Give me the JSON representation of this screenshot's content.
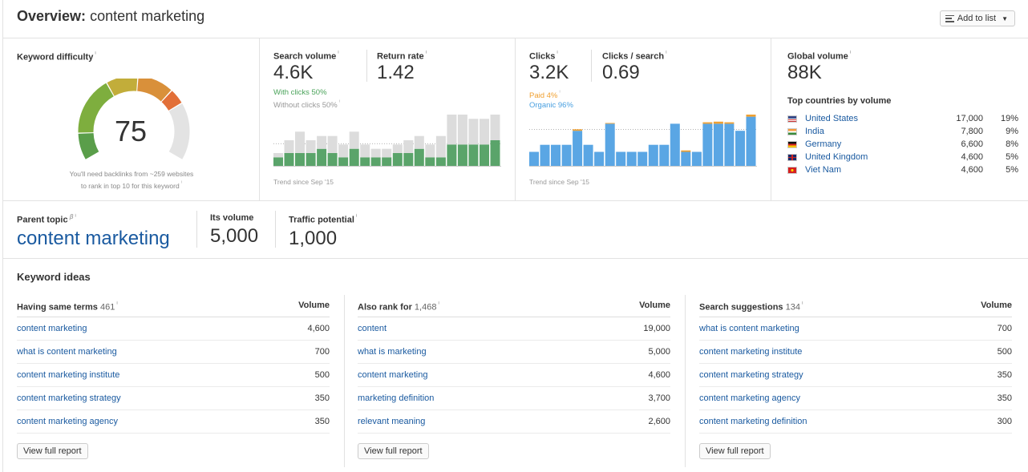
{
  "header": {
    "title_bold": "Overview:",
    "title_query": "content marketing",
    "add_to_list": "Add to list"
  },
  "keyword_difficulty": {
    "label": "Keyword difficulty",
    "value": "75",
    "score": 75,
    "note_line1": "You'll need backlinks from ~259 websites",
    "note_line2": "to rank in top 10 for this keyword"
  },
  "search_volume": {
    "label": "Search volume",
    "value": "4.6K",
    "return_rate_label": "Return rate",
    "return_rate": "1.42",
    "with_clicks": "With clicks 50%",
    "without_clicks": "Without clicks 50%",
    "trend": "Trend since Sep '15"
  },
  "clicks": {
    "label": "Clicks",
    "value": "3.2K",
    "cps_label": "Clicks / search",
    "cps": "0.69",
    "paid": "Paid 4%",
    "organic": "Organic 96%",
    "trend": "Trend since Sep '15"
  },
  "global": {
    "label": "Global volume",
    "value": "88K",
    "top_label": "Top countries by volume",
    "countries": [
      {
        "name": "United States",
        "volume": "17,000",
        "pct": "19%"
      },
      {
        "name": "India",
        "volume": "7,800",
        "pct": "9%"
      },
      {
        "name": "Germany",
        "volume": "6,600",
        "pct": "8%"
      },
      {
        "name": "United Kingdom",
        "volume": "4,600",
        "pct": "5%"
      },
      {
        "name": "Viet Nam",
        "volume": "4,600",
        "pct": "5%"
      }
    ]
  },
  "parent": {
    "label": "Parent topic",
    "beta": "β",
    "topic": "content marketing",
    "its_volume_label": "Its volume",
    "its_volume": "5,000",
    "traffic_label": "Traffic potential",
    "traffic": "1,000"
  },
  "ideas": {
    "title": "Keyword ideas",
    "volume_label": "Volume",
    "view_full": "View full report",
    "cols": [
      {
        "title": "Having same terms",
        "count": "461",
        "rows": [
          {
            "kw": "content marketing",
            "vol": "4,600"
          },
          {
            "kw": "what is content marketing",
            "vol": "700"
          },
          {
            "kw": "content marketing institute",
            "vol": "500"
          },
          {
            "kw": "content marketing strategy",
            "vol": "350"
          },
          {
            "kw": "content marketing agency",
            "vol": "350"
          }
        ]
      },
      {
        "title": "Also rank for",
        "count": "1,468",
        "rows": [
          {
            "kw": "content",
            "vol": "19,000"
          },
          {
            "kw": "what is marketing",
            "vol": "5,000"
          },
          {
            "kw": "content marketing",
            "vol": "4,600"
          },
          {
            "kw": "marketing definition",
            "vol": "3,700"
          },
          {
            "kw": "relevant meaning",
            "vol": "2,600"
          }
        ]
      },
      {
        "title": "Search suggestions",
        "count": "134",
        "rows": [
          {
            "kw": "what is content marketing",
            "vol": "700"
          },
          {
            "kw": "content marketing institute",
            "vol": "500"
          },
          {
            "kw": "content marketing strategy",
            "vol": "350"
          },
          {
            "kw": "content marketing agency",
            "vol": "350"
          },
          {
            "kw": "content marketing definition",
            "vol": "300"
          }
        ]
      }
    ]
  },
  "colors": {
    "link": "#1a5aa0",
    "green": "#5aa46a",
    "gray_bar": "#dcdcdc",
    "blue": "#5aa6e4",
    "paid": "#f0a030"
  },
  "chart_data": [
    {
      "type": "bar",
      "series": [
        {
          "name": "With clicks",
          "values": [
            2,
            3,
            3,
            3,
            4,
            3,
            2,
            4,
            2,
            2,
            2,
            3,
            3,
            4,
            2,
            2,
            5,
            5,
            5,
            5,
            6
          ]
        },
        {
          "name": "Without clicks",
          "values": [
            1,
            3,
            5,
            3,
            3,
            4,
            3,
            4,
            3,
            2,
            2,
            2,
            3,
            3,
            3,
            5,
            7,
            7,
            6,
            6,
            6
          ]
        }
      ]
    },
    {
      "type": "bar",
      "series": [
        {
          "name": "Organic",
          "values": [
            2,
            3,
            3,
            3,
            5,
            3,
            2,
            6,
            2,
            2,
            2,
            3,
            3,
            6,
            2,
            2,
            6,
            6,
            6,
            5,
            7
          ]
        },
        {
          "name": "Paid",
          "values": [
            0,
            0,
            0,
            0,
            0.2,
            0,
            0,
            0.1,
            0,
            0,
            0,
            0,
            0,
            0,
            0.2,
            0,
            0.2,
            0.3,
            0.2,
            0,
            0.3
          ]
        }
      ]
    }
  ]
}
